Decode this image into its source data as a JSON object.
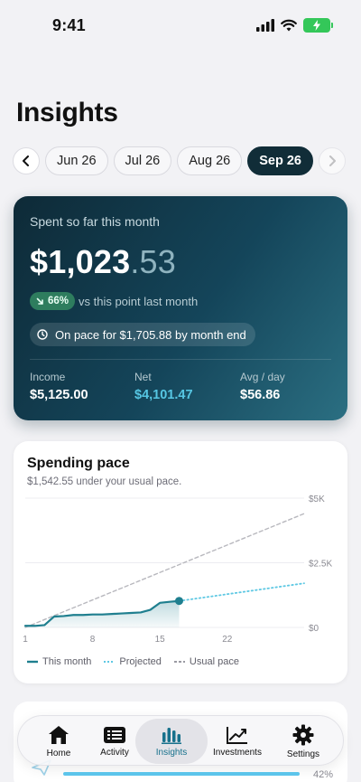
{
  "status_bar": {
    "time": "9:41"
  },
  "page_title": "Insights",
  "months": {
    "items": [
      "Jun 26",
      "Jul 26",
      "Aug 26",
      "Sep 26"
    ],
    "active_index": 3
  },
  "summary": {
    "label": "Spent so far this month",
    "amount_whole": "$1,023",
    "amount_cents": ".53",
    "badge": "66%",
    "compare_text": "vs this point last month",
    "pace_text": "On pace for $1,705.88 by month end",
    "stats": [
      {
        "label": "Income",
        "value": "$5,125.00"
      },
      {
        "label": "Net",
        "value": "$4,101.47"
      },
      {
        "label": "Avg / day",
        "value": "$56.86"
      }
    ]
  },
  "pace_card": {
    "title": "Spending pace",
    "subtitle": "$1,542.55 under your usual pace.",
    "legend": [
      "This month",
      "Projected",
      "Usual pace"
    ]
  },
  "chart_data": {
    "type": "line",
    "y_ticks": [
      "$5K",
      "$2.5K",
      "$0"
    ],
    "x_ticks": [
      "1",
      "8",
      "15",
      "22"
    ],
    "ylim": [
      0,
      5000
    ],
    "xlim": [
      1,
      30
    ],
    "series": [
      {
        "name": "This month",
        "style": "solid",
        "color": "#1f7f8f",
        "x": [
          1,
          2,
          3,
          4,
          5,
          6,
          7,
          8,
          9,
          10,
          11,
          12,
          13,
          14,
          15,
          16,
          17
        ],
        "y": [
          60,
          60,
          90,
          420,
          440,
          480,
          480,
          500,
          500,
          520,
          540,
          560,
          580,
          680,
          950,
          990,
          1023
        ]
      },
      {
        "name": "Projected",
        "style": "dotted",
        "color": "#5ec8e3",
        "x": [
          17,
          30
        ],
        "y": [
          1023,
          1706
        ]
      },
      {
        "name": "Usual pace",
        "style": "dashed",
        "color": "#b8b8be",
        "x": [
          1,
          30
        ],
        "y": [
          0,
          4400
        ]
      }
    ]
  },
  "next_card": {
    "progress_pct": "42%",
    "progress_value": 0.42
  },
  "tabs": [
    {
      "label": "Home",
      "icon": "house-icon"
    },
    {
      "label": "Activity",
      "icon": "list-icon"
    },
    {
      "label": "Insights",
      "icon": "bar-chart-icon"
    },
    {
      "label": "Investments",
      "icon": "trend-up-icon"
    },
    {
      "label": "Settings",
      "icon": "gear-icon"
    }
  ],
  "active_tab": 2,
  "colors": {
    "accent": "#17718c",
    "card_dark": "#0e2a37",
    "positive": "#2e7d5e",
    "net": "#56c6e3"
  }
}
